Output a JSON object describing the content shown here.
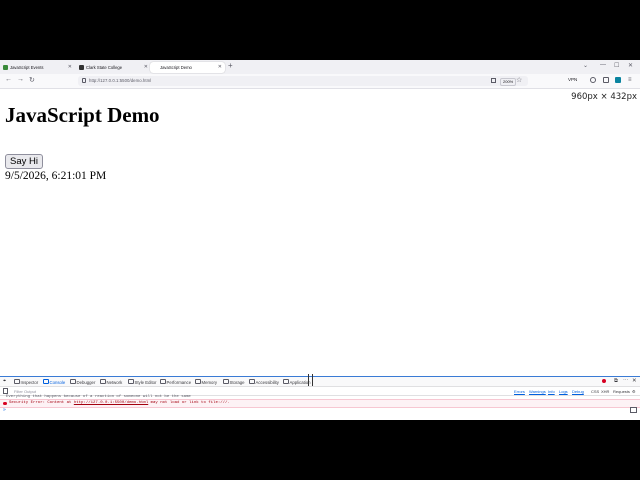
{
  "browser": {
    "tabs": [
      {
        "label": "JavaScript Events",
        "favicon_color": "#3a8a3a"
      },
      {
        "label": "Clark State College",
        "favicon_color": "#333333"
      },
      {
        "label": "JavaScript Demo",
        "favicon_color": "#ffffff"
      }
    ],
    "active_tab": 2,
    "url": "http://127.0.0.1:5500/demo.html",
    "zoom": "200%",
    "vpn_label": "VPN"
  },
  "page": {
    "viewport_size": "960px × 432px",
    "heading": "JavaScript Demo",
    "button_label": "Say Hi",
    "datetime": "9/5/2026, 6:21:01 PM"
  },
  "devtools": {
    "tabs": [
      "Inspector",
      "Console",
      "Debugger",
      "Network",
      "Style Editor",
      "Performance",
      "Memory",
      "Storage",
      "Accessibility",
      "Application"
    ],
    "active_tab": "Console",
    "filter_placeholder": "Filter Output",
    "filters": [
      "Errors",
      "Warnings",
      "Info",
      "Logs",
      "Debug"
    ],
    "right_filters": [
      "CSS",
      "XHR",
      "Requests"
    ],
    "truncated_message": "Everything that happens because of a reaction of someone will not be the same",
    "error": {
      "prefix": "Security Error: Content at ",
      "link": "http://127.0.0.1:5500/demo.html",
      "suffix": " may not load or link to file:///."
    },
    "prompt": "»"
  },
  "colors": {
    "accent": "#0060df",
    "error": "#d70022"
  }
}
